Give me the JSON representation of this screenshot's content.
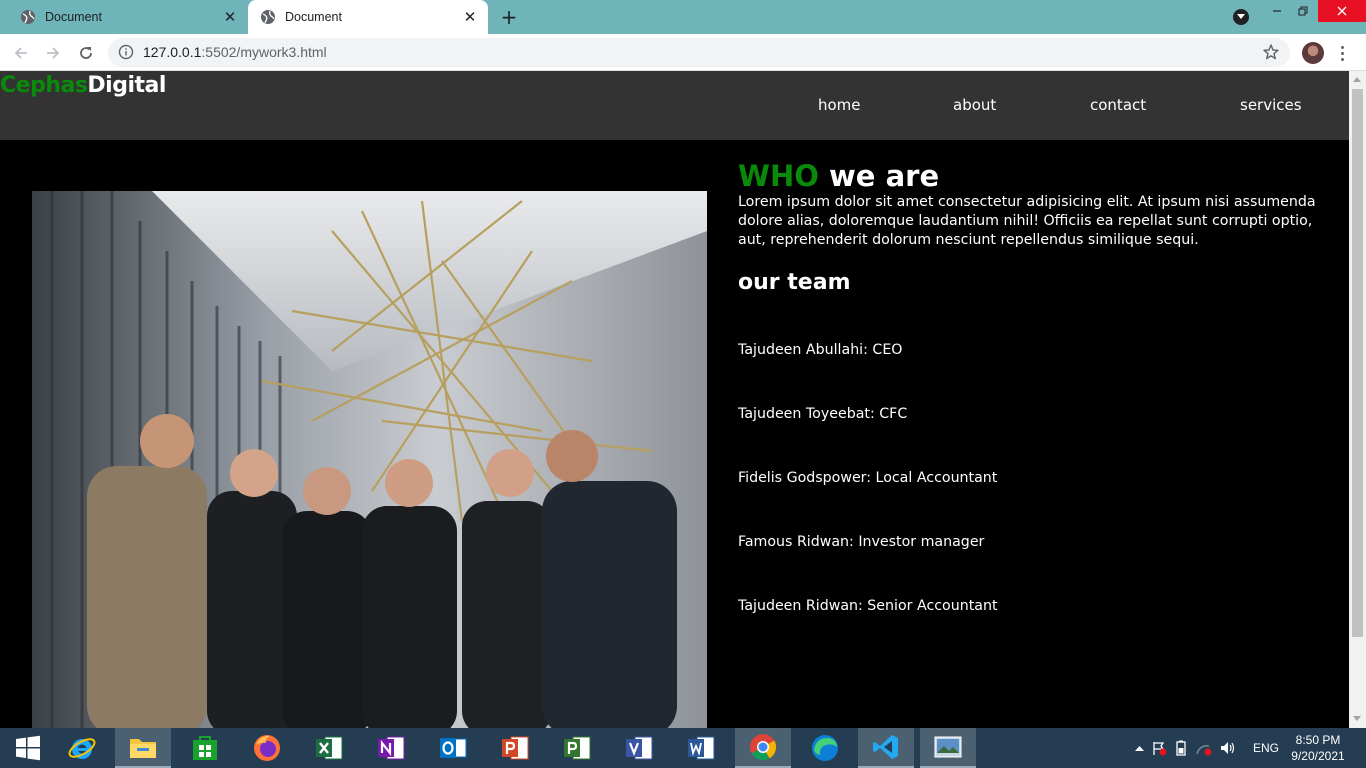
{
  "browser": {
    "tabs": [
      {
        "title": "Document",
        "active": false
      },
      {
        "title": "Document",
        "active": true
      }
    ],
    "url_host": "127.0.0.1",
    "url_rest": ":5502/mywork3.html"
  },
  "site": {
    "logo_green": "Cephas",
    "logo_white": "Digital",
    "nav": [
      "home",
      "about",
      "contact",
      "services"
    ],
    "heading_green": "WHO",
    "heading_white": " we are",
    "paragraph": "Lorem ipsum dolor sit amet consectetur adipisicing elit. At ipsum nisi assumenda dolore alias, doloremque laudantium nihil! Officiis ea repellat sunt corrupti optio, aut, reprehenderit dolorum nesciunt repellendus similique sequi.",
    "team_heading": "our team",
    "team": [
      "Tajudeen Abullahi: CEO",
      "Tajudeen Toyeebat: CFC",
      "Fidelis Godspower: Local Accountant",
      "Famous Ridwan: Investor manager",
      "Tajudeen Ridwan: Senior Accountant"
    ],
    "colors": {
      "accent": "#0a8a0a",
      "navbar": "#333333",
      "background": "#000000"
    }
  },
  "taskbar": {
    "apps": [
      "windows-start",
      "internet-explorer",
      "file-explorer",
      "microsoft-store",
      "firefox",
      "excel",
      "onenote",
      "outlook",
      "powerpoint",
      "project",
      "visio",
      "word",
      "chrome",
      "edge",
      "vscode",
      "photos"
    ],
    "language": "ENG",
    "time": "8:50 PM",
    "date": "9/20/2021"
  }
}
